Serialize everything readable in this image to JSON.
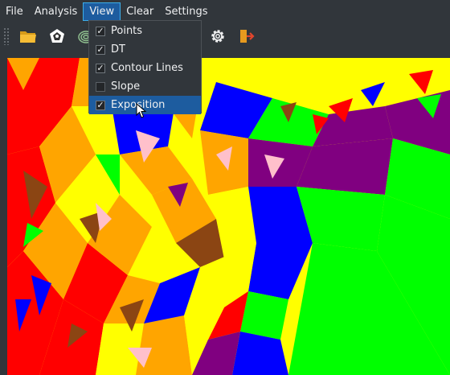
{
  "menubar": {
    "items": [
      {
        "label": "File"
      },
      {
        "label": "Analysis"
      },
      {
        "label": "View",
        "active": true
      },
      {
        "label": "Clear"
      },
      {
        "label": "Settings"
      }
    ]
  },
  "toolbar": {
    "icons": [
      "folder-open-icon",
      "points-icon",
      "contour-icon",
      "dt-icon",
      "clear-icon",
      "gear-icon",
      "exit-icon"
    ]
  },
  "view_menu": {
    "items": [
      {
        "label": "Points",
        "checked": true
      },
      {
        "label": "DT",
        "checked": true
      },
      {
        "label": "Contour Lines",
        "checked": true
      },
      {
        "label": "Slope",
        "checked": false
      },
      {
        "label": "Exposition",
        "checked": true,
        "highlighted": true
      }
    ]
  },
  "check_glyph": "✓",
  "palette": {
    "red": "#ff0000",
    "orange": "#ffa500",
    "yellow": "#ffff00",
    "green": "#00ff00",
    "blue": "#0000ff",
    "purple": "#800080",
    "brown": "#8b4513",
    "pink": "#ffc0cb",
    "accent": "#3daee9"
  }
}
